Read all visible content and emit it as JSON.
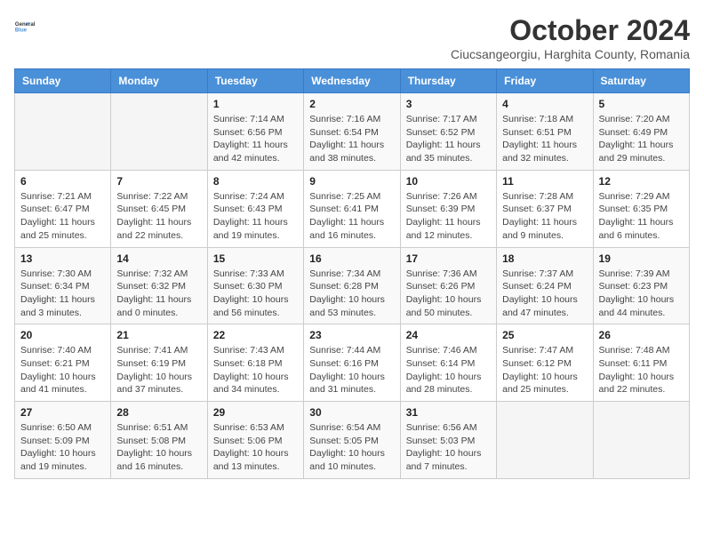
{
  "header": {
    "logo_line1": "General",
    "logo_line2": "Blue",
    "month_title": "October 2024",
    "subtitle": "Ciucsangeorgiu, Harghita County, Romania"
  },
  "weekdays": [
    "Sunday",
    "Monday",
    "Tuesday",
    "Wednesday",
    "Thursday",
    "Friday",
    "Saturday"
  ],
  "weeks": [
    [
      {
        "day": "",
        "sunrise": "",
        "sunset": "",
        "daylight": ""
      },
      {
        "day": "",
        "sunrise": "",
        "sunset": "",
        "daylight": ""
      },
      {
        "day": "1",
        "sunrise": "Sunrise: 7:14 AM",
        "sunset": "Sunset: 6:56 PM",
        "daylight": "Daylight: 11 hours and 42 minutes."
      },
      {
        "day": "2",
        "sunrise": "Sunrise: 7:16 AM",
        "sunset": "Sunset: 6:54 PM",
        "daylight": "Daylight: 11 hours and 38 minutes."
      },
      {
        "day": "3",
        "sunrise": "Sunrise: 7:17 AM",
        "sunset": "Sunset: 6:52 PM",
        "daylight": "Daylight: 11 hours and 35 minutes."
      },
      {
        "day": "4",
        "sunrise": "Sunrise: 7:18 AM",
        "sunset": "Sunset: 6:51 PM",
        "daylight": "Daylight: 11 hours and 32 minutes."
      },
      {
        "day": "5",
        "sunrise": "Sunrise: 7:20 AM",
        "sunset": "Sunset: 6:49 PM",
        "daylight": "Daylight: 11 hours and 29 minutes."
      }
    ],
    [
      {
        "day": "6",
        "sunrise": "Sunrise: 7:21 AM",
        "sunset": "Sunset: 6:47 PM",
        "daylight": "Daylight: 11 hours and 25 minutes."
      },
      {
        "day": "7",
        "sunrise": "Sunrise: 7:22 AM",
        "sunset": "Sunset: 6:45 PM",
        "daylight": "Daylight: 11 hours and 22 minutes."
      },
      {
        "day": "8",
        "sunrise": "Sunrise: 7:24 AM",
        "sunset": "Sunset: 6:43 PM",
        "daylight": "Daylight: 11 hours and 19 minutes."
      },
      {
        "day": "9",
        "sunrise": "Sunrise: 7:25 AM",
        "sunset": "Sunset: 6:41 PM",
        "daylight": "Daylight: 11 hours and 16 minutes."
      },
      {
        "day": "10",
        "sunrise": "Sunrise: 7:26 AM",
        "sunset": "Sunset: 6:39 PM",
        "daylight": "Daylight: 11 hours and 12 minutes."
      },
      {
        "day": "11",
        "sunrise": "Sunrise: 7:28 AM",
        "sunset": "Sunset: 6:37 PM",
        "daylight": "Daylight: 11 hours and 9 minutes."
      },
      {
        "day": "12",
        "sunrise": "Sunrise: 7:29 AM",
        "sunset": "Sunset: 6:35 PM",
        "daylight": "Daylight: 11 hours and 6 minutes."
      }
    ],
    [
      {
        "day": "13",
        "sunrise": "Sunrise: 7:30 AM",
        "sunset": "Sunset: 6:34 PM",
        "daylight": "Daylight: 11 hours and 3 minutes."
      },
      {
        "day": "14",
        "sunrise": "Sunrise: 7:32 AM",
        "sunset": "Sunset: 6:32 PM",
        "daylight": "Daylight: 11 hours and 0 minutes."
      },
      {
        "day": "15",
        "sunrise": "Sunrise: 7:33 AM",
        "sunset": "Sunset: 6:30 PM",
        "daylight": "Daylight: 10 hours and 56 minutes."
      },
      {
        "day": "16",
        "sunrise": "Sunrise: 7:34 AM",
        "sunset": "Sunset: 6:28 PM",
        "daylight": "Daylight: 10 hours and 53 minutes."
      },
      {
        "day": "17",
        "sunrise": "Sunrise: 7:36 AM",
        "sunset": "Sunset: 6:26 PM",
        "daylight": "Daylight: 10 hours and 50 minutes."
      },
      {
        "day": "18",
        "sunrise": "Sunrise: 7:37 AM",
        "sunset": "Sunset: 6:24 PM",
        "daylight": "Daylight: 10 hours and 47 minutes."
      },
      {
        "day": "19",
        "sunrise": "Sunrise: 7:39 AM",
        "sunset": "Sunset: 6:23 PM",
        "daylight": "Daylight: 10 hours and 44 minutes."
      }
    ],
    [
      {
        "day": "20",
        "sunrise": "Sunrise: 7:40 AM",
        "sunset": "Sunset: 6:21 PM",
        "daylight": "Daylight: 10 hours and 41 minutes."
      },
      {
        "day": "21",
        "sunrise": "Sunrise: 7:41 AM",
        "sunset": "Sunset: 6:19 PM",
        "daylight": "Daylight: 10 hours and 37 minutes."
      },
      {
        "day": "22",
        "sunrise": "Sunrise: 7:43 AM",
        "sunset": "Sunset: 6:18 PM",
        "daylight": "Daylight: 10 hours and 34 minutes."
      },
      {
        "day": "23",
        "sunrise": "Sunrise: 7:44 AM",
        "sunset": "Sunset: 6:16 PM",
        "daylight": "Daylight: 10 hours and 31 minutes."
      },
      {
        "day": "24",
        "sunrise": "Sunrise: 7:46 AM",
        "sunset": "Sunset: 6:14 PM",
        "daylight": "Daylight: 10 hours and 28 minutes."
      },
      {
        "day": "25",
        "sunrise": "Sunrise: 7:47 AM",
        "sunset": "Sunset: 6:12 PM",
        "daylight": "Daylight: 10 hours and 25 minutes."
      },
      {
        "day": "26",
        "sunrise": "Sunrise: 7:48 AM",
        "sunset": "Sunset: 6:11 PM",
        "daylight": "Daylight: 10 hours and 22 minutes."
      }
    ],
    [
      {
        "day": "27",
        "sunrise": "Sunrise: 6:50 AM",
        "sunset": "Sunset: 5:09 PM",
        "daylight": "Daylight: 10 hours and 19 minutes."
      },
      {
        "day": "28",
        "sunrise": "Sunrise: 6:51 AM",
        "sunset": "Sunset: 5:08 PM",
        "daylight": "Daylight: 10 hours and 16 minutes."
      },
      {
        "day": "29",
        "sunrise": "Sunrise: 6:53 AM",
        "sunset": "Sunset: 5:06 PM",
        "daylight": "Daylight: 10 hours and 13 minutes."
      },
      {
        "day": "30",
        "sunrise": "Sunrise: 6:54 AM",
        "sunset": "Sunset: 5:05 PM",
        "daylight": "Daylight: 10 hours and 10 minutes."
      },
      {
        "day": "31",
        "sunrise": "Sunrise: 6:56 AM",
        "sunset": "Sunset: 5:03 PM",
        "daylight": "Daylight: 10 hours and 7 minutes."
      },
      {
        "day": "",
        "sunrise": "",
        "sunset": "",
        "daylight": ""
      },
      {
        "day": "",
        "sunrise": "",
        "sunset": "",
        "daylight": ""
      }
    ]
  ]
}
